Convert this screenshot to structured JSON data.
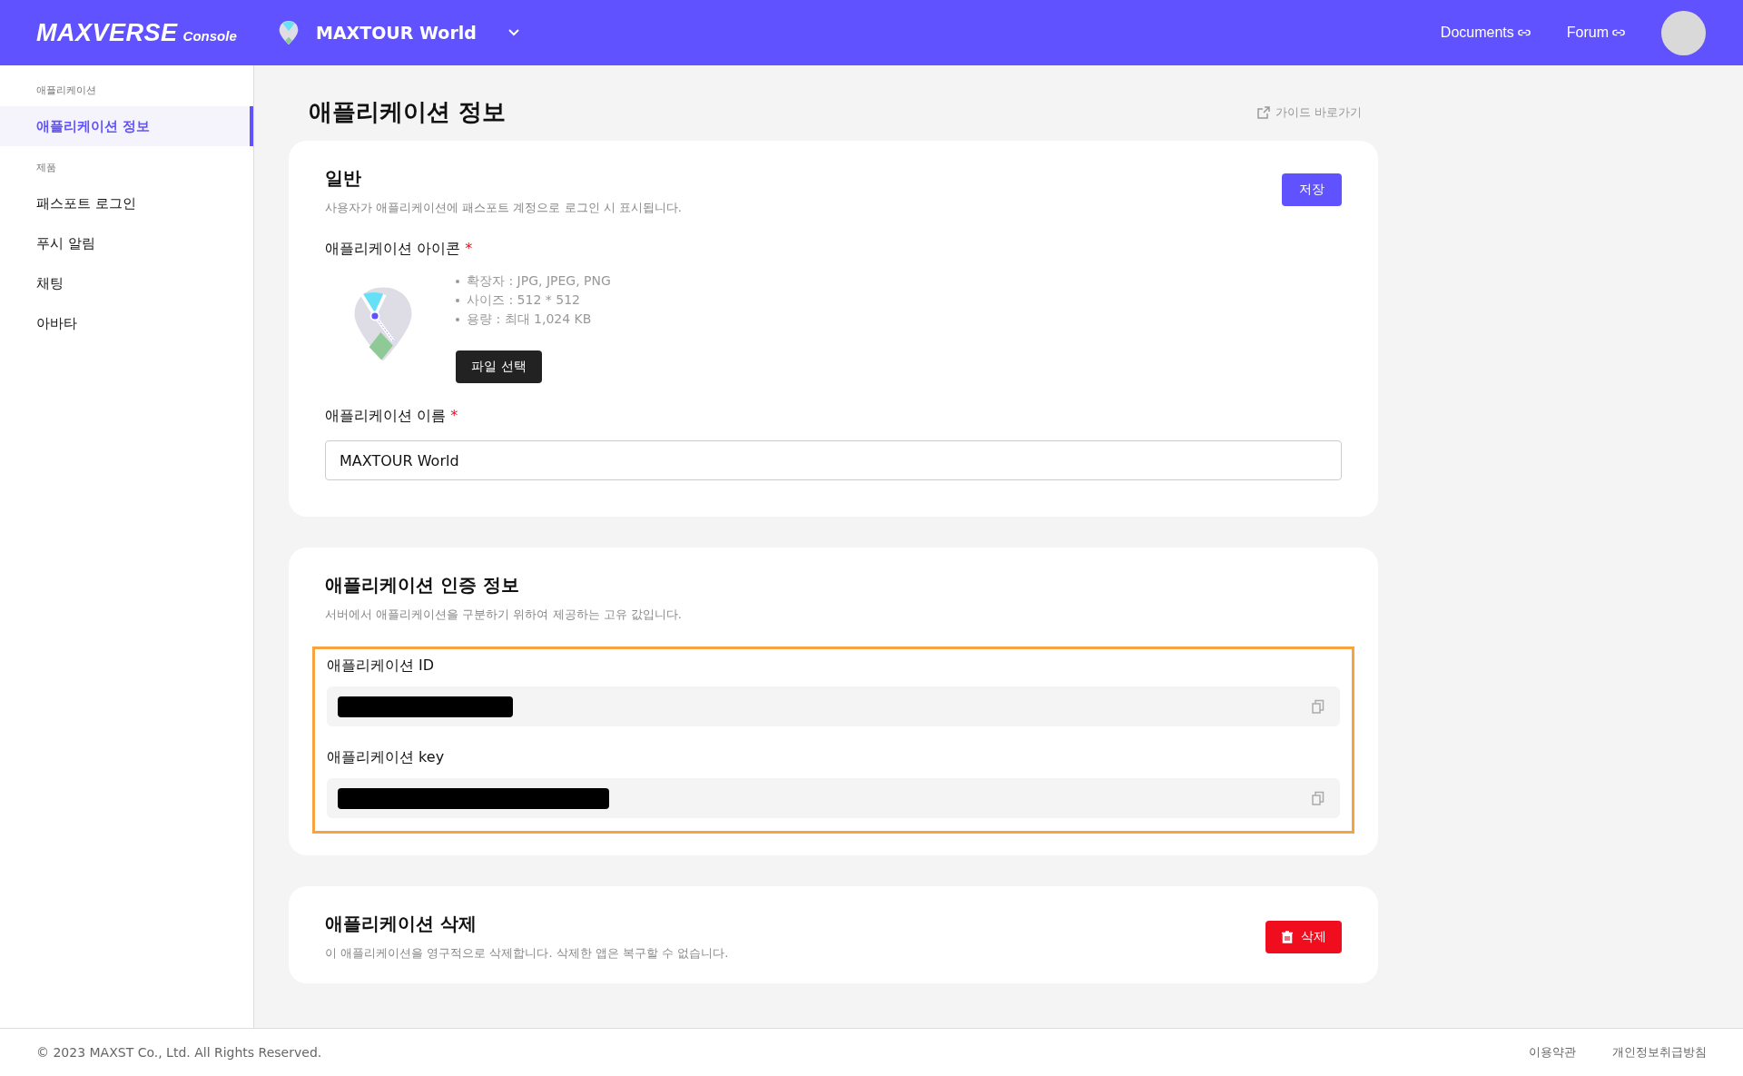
{
  "header": {
    "logo": "MAXVERSE",
    "logo_sub": "Console",
    "app_name": "MAXTOUR World",
    "links": [
      "Documents",
      "Forum"
    ]
  },
  "sidebar": {
    "sections": [
      {
        "label": "애플리케이션",
        "items": [
          {
            "label": "애플리케이션 정보",
            "selected": true
          }
        ]
      },
      {
        "label": "제품",
        "items": [
          {
            "label": "패스포트 로그인",
            "selected": false
          },
          {
            "label": "푸시 알림",
            "selected": false
          },
          {
            "label": "채팅",
            "selected": false
          },
          {
            "label": "아바타",
            "selected": false
          }
        ]
      }
    ]
  },
  "page": {
    "title": "애플리케이션 정보",
    "guide_link": "가이드 바로가기"
  },
  "general": {
    "title": "일반",
    "description": "사용자가 애플리케이션에 패스포트 계정으로 로그인 시 표시됩니다.",
    "save_button": "저장",
    "icon_label": "애플리케이션 아이콘",
    "required_mark": "*",
    "icon_rules": [
      "확장자 : JPG, JPEG, PNG",
      "사이즈 : 512 * 512",
      "용량 : 최대 1,024 KB"
    ],
    "file_button": "파일 선택",
    "name_label": "애플리케이션 이름",
    "name_value": "MAXTOUR World"
  },
  "auth": {
    "title": "애플리케이션 인증 정보",
    "description": "서버에서 애플리케이션을 구분하기 위하여 제공하는 고유 값입니다.",
    "highlighted": true,
    "fields": [
      {
        "label": "애플리케이션 ID",
        "masked": true
      },
      {
        "label": "애플리케이션 key",
        "masked": true
      }
    ]
  },
  "delete": {
    "title": "애플리케이션 삭제",
    "description": "이 애플리케이션을 영구적으로 삭제합니다. 삭제한 앱은 복구할 수 없습니다.",
    "button": "삭제"
  },
  "footer": {
    "copyright": "© 2023 MAXST Co., Ltd. All Rights Reserved.",
    "links": [
      "이용약관",
      "개인정보취급방침"
    ]
  }
}
